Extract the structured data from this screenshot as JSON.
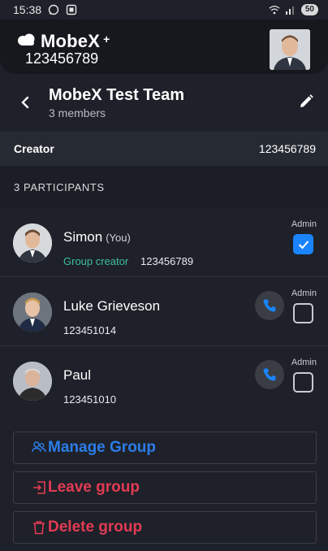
{
  "status_bar": {
    "time": "15:38",
    "battery": "50"
  },
  "brand": {
    "name": "MobeX",
    "plus": "+",
    "number": "123456789"
  },
  "header": {
    "title": "MobeX Test Team",
    "subtitle": "3 members"
  },
  "creator": {
    "label": "Creator",
    "value": "123456789"
  },
  "participants_header": "3 PARTICIPANTS",
  "participants": [
    {
      "name": "Simon",
      "you": "(You)",
      "role": "Group creator",
      "number": "123456789",
      "admin_label": "Admin",
      "admin": true
    },
    {
      "name": "Luke Grieveson",
      "number": "123451014",
      "admin_label": "Admin",
      "admin": false
    },
    {
      "name": "Paul",
      "number": "123451010",
      "admin_label": "Admin",
      "admin": false
    }
  ],
  "actions": {
    "manage": "Manage Group",
    "leave": "Leave group",
    "delete": "Delete group"
  },
  "colors": {
    "background": "#1e2129",
    "accent_blue": "#2b7de9",
    "danger_red": "#e23b54",
    "creator_green": "#3dbf9a",
    "checkbox_blue": "#1a84ff"
  }
}
